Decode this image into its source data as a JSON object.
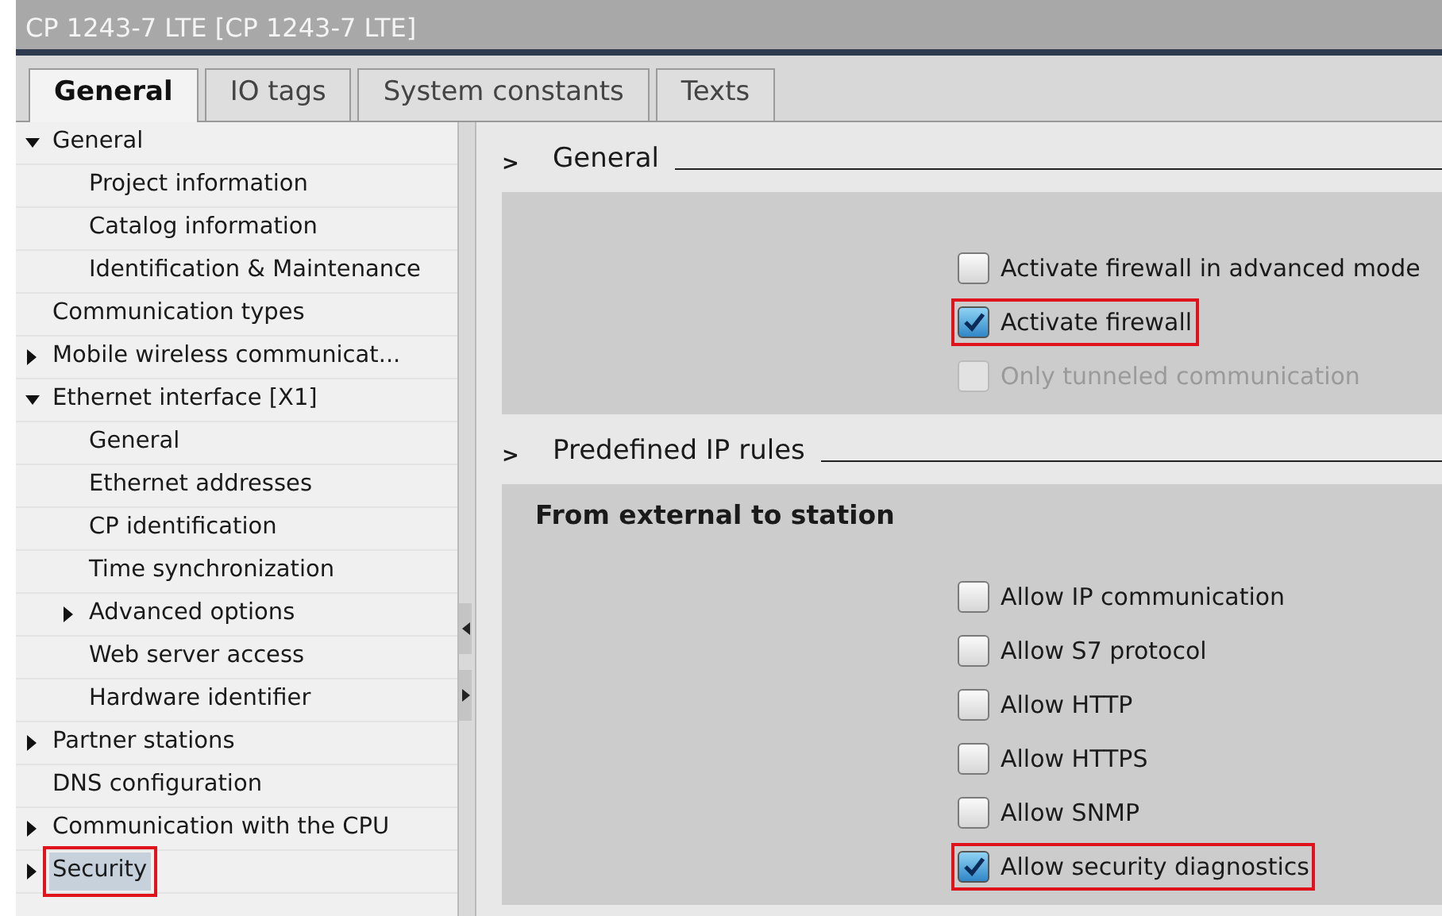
{
  "window": {
    "title": "CP 1243-7 LTE [CP 1243-7 LTE]"
  },
  "tabs": [
    {
      "label": "General",
      "selected": true
    },
    {
      "label": "IO tags",
      "selected": false
    },
    {
      "label": "System constants",
      "selected": false
    },
    {
      "label": "Texts",
      "selected": false
    }
  ],
  "tree": [
    {
      "label": "General",
      "kind": "folder",
      "expanded": true,
      "selected": false,
      "highlighted": false,
      "children": [
        {
          "label": "Project information",
          "kind": "leaf",
          "selected": false,
          "highlighted": false
        },
        {
          "label": "Catalog information",
          "kind": "leaf",
          "selected": false,
          "highlighted": false
        },
        {
          "label": "Identification & Maintenance",
          "kind": "leaf",
          "selected": false,
          "highlighted": false
        }
      ]
    },
    {
      "label": "Communication types",
      "kind": "leaf",
      "selected": false,
      "highlighted": false
    },
    {
      "label": "Mobile wireless communicat...",
      "kind": "folder",
      "expanded": false,
      "selected": false,
      "highlighted": false
    },
    {
      "label": "Ethernet interface [X1]",
      "kind": "folder",
      "expanded": true,
      "selected": false,
      "highlighted": false,
      "children": [
        {
          "label": "General",
          "kind": "leaf",
          "selected": false,
          "highlighted": false
        },
        {
          "label": "Ethernet addresses",
          "kind": "leaf",
          "selected": false,
          "highlighted": false
        },
        {
          "label": "CP identification",
          "kind": "leaf",
          "selected": false,
          "highlighted": false
        },
        {
          "label": "Time synchronization",
          "kind": "leaf",
          "selected": false,
          "highlighted": false
        },
        {
          "label": "Advanced options",
          "kind": "folder",
          "expanded": false,
          "selected": false,
          "highlighted": false
        },
        {
          "label": "Web server access",
          "kind": "leaf",
          "selected": false,
          "highlighted": false
        },
        {
          "label": "Hardware identifier",
          "kind": "leaf",
          "selected": false,
          "highlighted": false
        }
      ]
    },
    {
      "label": "Partner stations",
      "kind": "folder",
      "expanded": false,
      "selected": false,
      "highlighted": false
    },
    {
      "label": "DNS configuration",
      "kind": "leaf",
      "selected": false,
      "highlighted": false
    },
    {
      "label": "Communication with the CPU",
      "kind": "folder",
      "expanded": false,
      "selected": false,
      "highlighted": false
    },
    {
      "label": "Security",
      "kind": "folder",
      "expanded": false,
      "selected": true,
      "highlighted": true
    }
  ],
  "sections": [
    {
      "title": "General",
      "expander": ">",
      "options": [
        {
          "label": "Activate firewall in advanced mode",
          "checked": false,
          "disabled": false,
          "highlighted": false
        },
        {
          "label": "Activate firewall",
          "checked": true,
          "disabled": false,
          "highlighted": true
        },
        {
          "label": "Only tunneled communication",
          "checked": false,
          "disabled": true,
          "highlighted": false
        }
      ]
    },
    {
      "title": "Predefined IP rules",
      "expander": ">",
      "subtitle": "From external to station",
      "options": [
        {
          "label": "Allow IP communication",
          "checked": false,
          "disabled": false,
          "highlighted": false
        },
        {
          "label": "Allow S7 protocol",
          "checked": false,
          "disabled": false,
          "highlighted": false
        },
        {
          "label": "Allow HTTP",
          "checked": false,
          "disabled": false,
          "highlighted": false
        },
        {
          "label": "Allow HTTPS",
          "checked": false,
          "disabled": false,
          "highlighted": false
        },
        {
          "label": "Allow SNMP",
          "checked": false,
          "disabled": false,
          "highlighted": false
        },
        {
          "label": "Allow security diagnostics",
          "checked": true,
          "disabled": false,
          "highlighted": true
        }
      ]
    }
  ]
}
